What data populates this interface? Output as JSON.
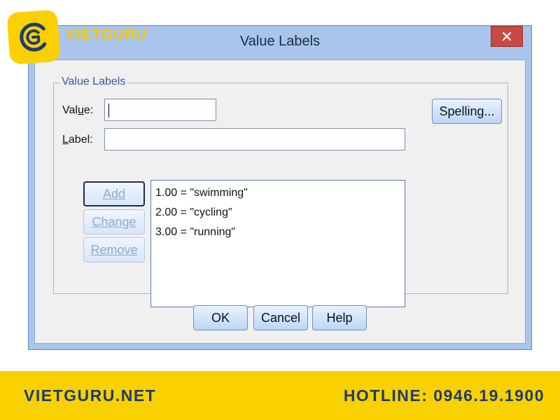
{
  "brand": {
    "name": "VIETGURU"
  },
  "window": {
    "title": "Value Labels",
    "close_glyph": "×"
  },
  "group": {
    "legend": "Value Labels"
  },
  "form": {
    "value_label": "Value:",
    "value_input": "",
    "label_label": "Label:",
    "label_input": ""
  },
  "buttons": {
    "spelling": "Spelling...",
    "add": "Add",
    "change": "Change",
    "remove": "Remove",
    "ok": "OK",
    "cancel": "Cancel",
    "help": "Help"
  },
  "list": {
    "items": [
      "1.00 = \"swimming\"",
      "2.00 = \"cycling\"",
      "3.00 = \"running\""
    ]
  },
  "footer": {
    "website": "VIETGURU.NET",
    "hotline": "HOTLINE: 0946.19.1900"
  },
  "colors": {
    "window_frame": "#a9c5ec",
    "close_button": "#c74a43",
    "client_bg": "#f0f0f0",
    "brand_yellow": "#f9d000",
    "brand_navy": "#1d3c72"
  },
  "icons": {
    "close": "close-icon",
    "logo": "vietguru-logo-icon"
  }
}
